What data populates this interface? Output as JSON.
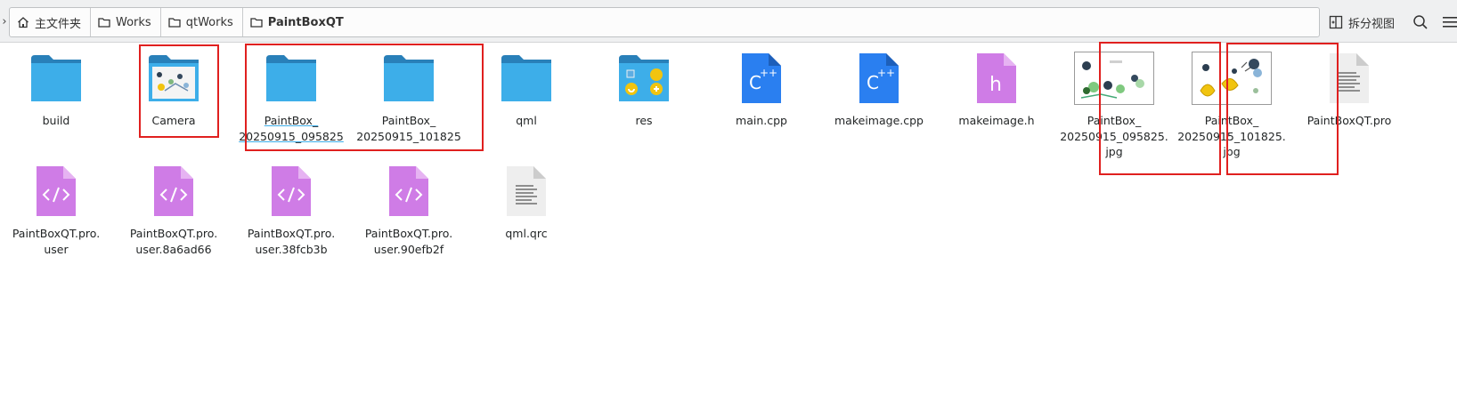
{
  "breadcrumb": {
    "items": [
      {
        "label": "主文件夹",
        "icon": "home-icon"
      },
      {
        "label": "Works",
        "icon": "folder-icon"
      },
      {
        "label": "qtWorks",
        "icon": "folder-icon"
      },
      {
        "label": "PaintBoxQT",
        "icon": "folder-icon"
      }
    ]
  },
  "toolbar": {
    "split_view_label": "拆分视图"
  },
  "files": {
    "build": {
      "lines": [
        "build"
      ]
    },
    "camera": {
      "lines": [
        "Camera"
      ]
    },
    "pb1": {
      "lines": [
        "PaintBox_",
        "20250915_095825"
      ]
    },
    "pb2": {
      "lines": [
        "PaintBox_",
        "20250915_101825"
      ]
    },
    "qml": {
      "lines": [
        "qml"
      ]
    },
    "res": {
      "lines": [
        "res"
      ]
    },
    "main_cpp": {
      "lines": [
        "main.cpp"
      ]
    },
    "makeimage_cpp": {
      "lines": [
        "makeimage.cpp"
      ]
    },
    "makeimage_h": {
      "lines": [
        "makeimage.h"
      ]
    },
    "jpg1": {
      "lines": [
        "PaintBox_",
        "20250915_095825.",
        "jpg"
      ]
    },
    "jpg2": {
      "lines": [
        "PaintBox_",
        "20250915_101825.",
        "jpg"
      ]
    },
    "pro": {
      "lines": [
        "PaintBoxQT.pro"
      ]
    },
    "user": {
      "lines": [
        "PaintBoxQT.pro.",
        "user"
      ]
    },
    "user1": {
      "lines": [
        "PaintBoxQT.pro.",
        "user.8a6ad66"
      ]
    },
    "user2": {
      "lines": [
        "PaintBoxQT.pro.",
        "user.38fcb3b"
      ]
    },
    "user3": {
      "lines": [
        "PaintBoxQT.pro.",
        "user.90efb2f"
      ]
    },
    "qrc": {
      "lines": [
        "qml.qrc"
      ]
    }
  },
  "icons": {
    "folder": "folder-icon",
    "image_folder": "image-folder-icon",
    "resource_folder": "resource-folder-icon",
    "cpp": "cpp-source-icon",
    "header": "header-file-icon",
    "image": "image-thumbnail-icon",
    "text": "text-file-icon",
    "xml": "xml-file-icon"
  },
  "colors": {
    "folder_blue": "#3daee9",
    "folder_tab": "#2980b9",
    "cpp_blue": "#2a7ff0",
    "header_purple": "#cf7ce6",
    "highlight_red": "#e0201f"
  }
}
